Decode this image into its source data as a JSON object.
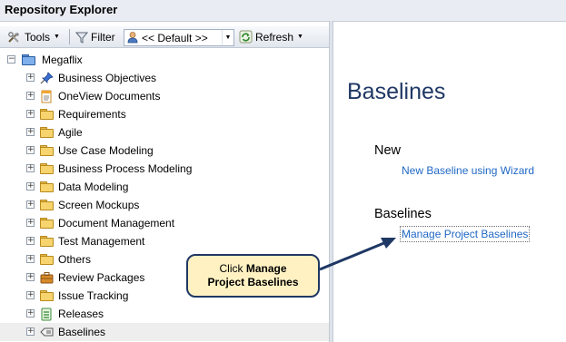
{
  "window": {
    "title": "Repository Explorer"
  },
  "toolbar": {
    "tools_label": "Tools",
    "filter_label": "Filter",
    "view_value": "<< Default >>",
    "refresh_label": "Refresh"
  },
  "tree": {
    "root": "Megaflix",
    "items": [
      {
        "label": "Business Objectives",
        "icon": "pushpin-icon"
      },
      {
        "label": "OneView Documents",
        "icon": "document-icon"
      },
      {
        "label": "Requirements",
        "icon": "folder-icon"
      },
      {
        "label": "Agile",
        "icon": "folder-icon"
      },
      {
        "label": "Use Case Modeling",
        "icon": "folder-icon"
      },
      {
        "label": "Business Process Modeling",
        "icon": "folder-icon"
      },
      {
        "label": "Data Modeling",
        "icon": "folder-icon"
      },
      {
        "label": "Screen Mockups",
        "icon": "folder-icon"
      },
      {
        "label": "Document Management",
        "icon": "folder-icon"
      },
      {
        "label": "Test Management",
        "icon": "folder-icon"
      },
      {
        "label": "Others",
        "icon": "folder-icon"
      },
      {
        "label": "Review Packages",
        "icon": "briefcase-icon"
      },
      {
        "label": "Issue Tracking",
        "icon": "folder-icon"
      },
      {
        "label": "Releases",
        "icon": "release-icon"
      },
      {
        "label": "Baselines",
        "icon": "baseline-icon",
        "selected": true
      }
    ]
  },
  "main": {
    "title": "Baselines",
    "new_heading": "New",
    "new_link": "New Baseline using Wizard",
    "baselines_heading": "Baselines",
    "manage_link": "Manage Project Baselines"
  },
  "callout": {
    "prefix": "Click ",
    "bold_line1": "Manage",
    "bold_line2": "Project Baselines"
  },
  "colors": {
    "link": "#2068c5",
    "title": "#1f3864",
    "callout_fill": "#fff1c2",
    "callout_border": "#1f3864"
  }
}
